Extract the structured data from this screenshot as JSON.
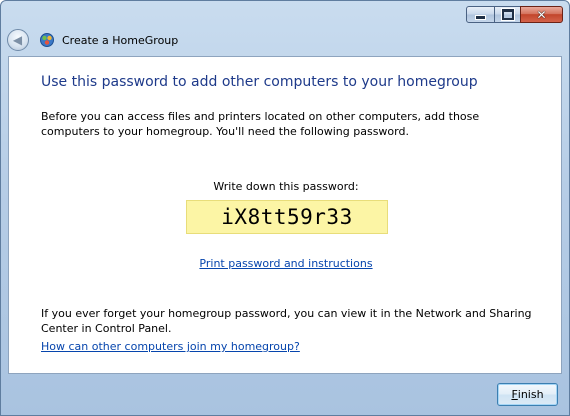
{
  "window": {
    "title": "Create a HomeGroup",
    "close_glyph": "✕",
    "back_arrow": "◀"
  },
  "content": {
    "heading": "Use this password to add other computers to your homegroup",
    "intro": "Before you can access files and printers located on other computers, add those computers to your homegroup.  You'll need the following password.",
    "password_label": "Write down this password:",
    "password": "iX8tt59r33",
    "print_link": "Print password and instructions",
    "forget_text": "If you ever forget your homegroup password, you can view it in the Network and Sharing Center in Control Panel.",
    "join_link": "How can other computers join my homegroup?"
  },
  "buttons": {
    "finish_mnemonic": "F",
    "finish_rest": "inish"
  },
  "icons": {
    "back": "back-arrow-icon",
    "homegroup": "homegroup-icon",
    "minimize": "minimize-icon",
    "maximize": "maximize-icon",
    "close": "close-icon"
  },
  "colors": {
    "heading": "#1e3a8a",
    "link": "#0645ad",
    "password_bg": "#fcf5a5",
    "close_button": "#c2452b"
  }
}
